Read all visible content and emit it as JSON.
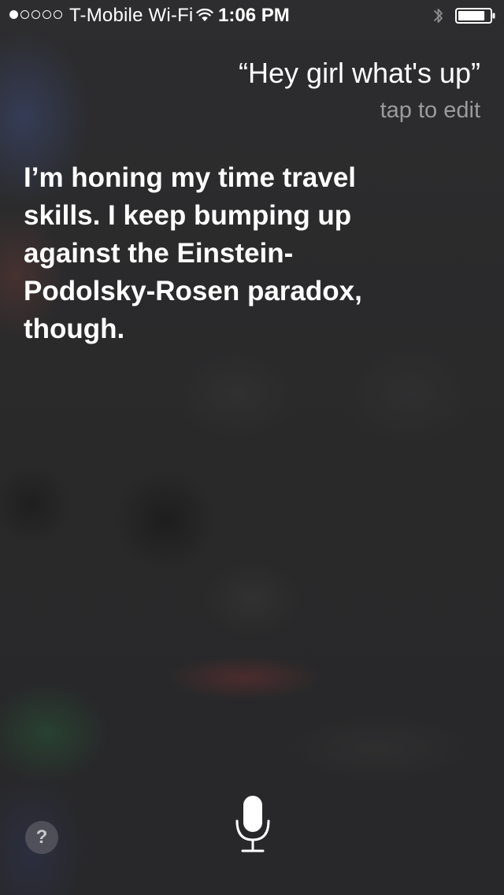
{
  "status_bar": {
    "signal_bars_filled": 1,
    "signal_bars_total": 5,
    "carrier": "T-Mobile Wi-Fi",
    "wifi_icon": "wifi-icon",
    "time": "1:06 PM",
    "bluetooth_icon": "bluetooth-icon",
    "battery_icon": "battery-icon",
    "battery_level": 0.85
  },
  "conversation": {
    "query": "“Hey girl what's up”",
    "tap_to_edit": "tap to edit",
    "response": "I’m honing my time travel skills. I keep bumping up against the Einstein-Podolsky-Rosen paradox, though."
  },
  "controls": {
    "help_label": "?",
    "help_icon": "question-mark-icon",
    "mic_icon": "microphone-icon"
  },
  "colors": {
    "background": "#2a2a2b",
    "text_primary": "#ffffff",
    "text_secondary": "#9b9b9d"
  }
}
